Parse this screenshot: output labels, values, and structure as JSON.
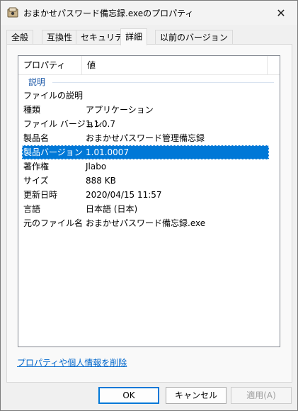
{
  "window": {
    "title": "おまかせパスワード備忘録.exeのプロパティ"
  },
  "tabs": [
    {
      "label": "全般"
    },
    {
      "label": "互換性"
    },
    {
      "label": "セキュリティ"
    },
    {
      "label": "詳細"
    },
    {
      "label": "以前のバージョン"
    }
  ],
  "active_tab": "詳細",
  "list": {
    "columns": [
      "プロパティ",
      "値"
    ],
    "group": "説明",
    "rows": [
      {
        "key": "ファイルの説明",
        "value": ""
      },
      {
        "key": "種類",
        "value": "アプリケーション"
      },
      {
        "key": "ファイル バージョン",
        "value": "1.1.0.7"
      },
      {
        "key": "製品名",
        "value": "おまかせパスワード管理備忘録"
      },
      {
        "key": "製品バージョン",
        "value": "1.01.0007"
      },
      {
        "key": "著作権",
        "value": "Jlabo"
      },
      {
        "key": "サイズ",
        "value": "888 KB"
      },
      {
        "key": "更新日時",
        "value": "2020/04/15 11:57"
      },
      {
        "key": "言語",
        "value": "日本語 (日本)"
      },
      {
        "key": "元のファイル名",
        "value": "おまかせパスワード備忘録.exe"
      }
    ],
    "selected_row": "製品バージョン"
  },
  "link": "プロパティや個人情報を削除",
  "buttons": {
    "ok": "OK",
    "cancel": "キャンセル",
    "apply": "適用(A)"
  },
  "colors": {
    "selection": "#0078d7",
    "link": "#0066cc",
    "group": "#1e5aa8"
  },
  "icons": {
    "app": "app-icon",
    "close": "close-icon"
  }
}
